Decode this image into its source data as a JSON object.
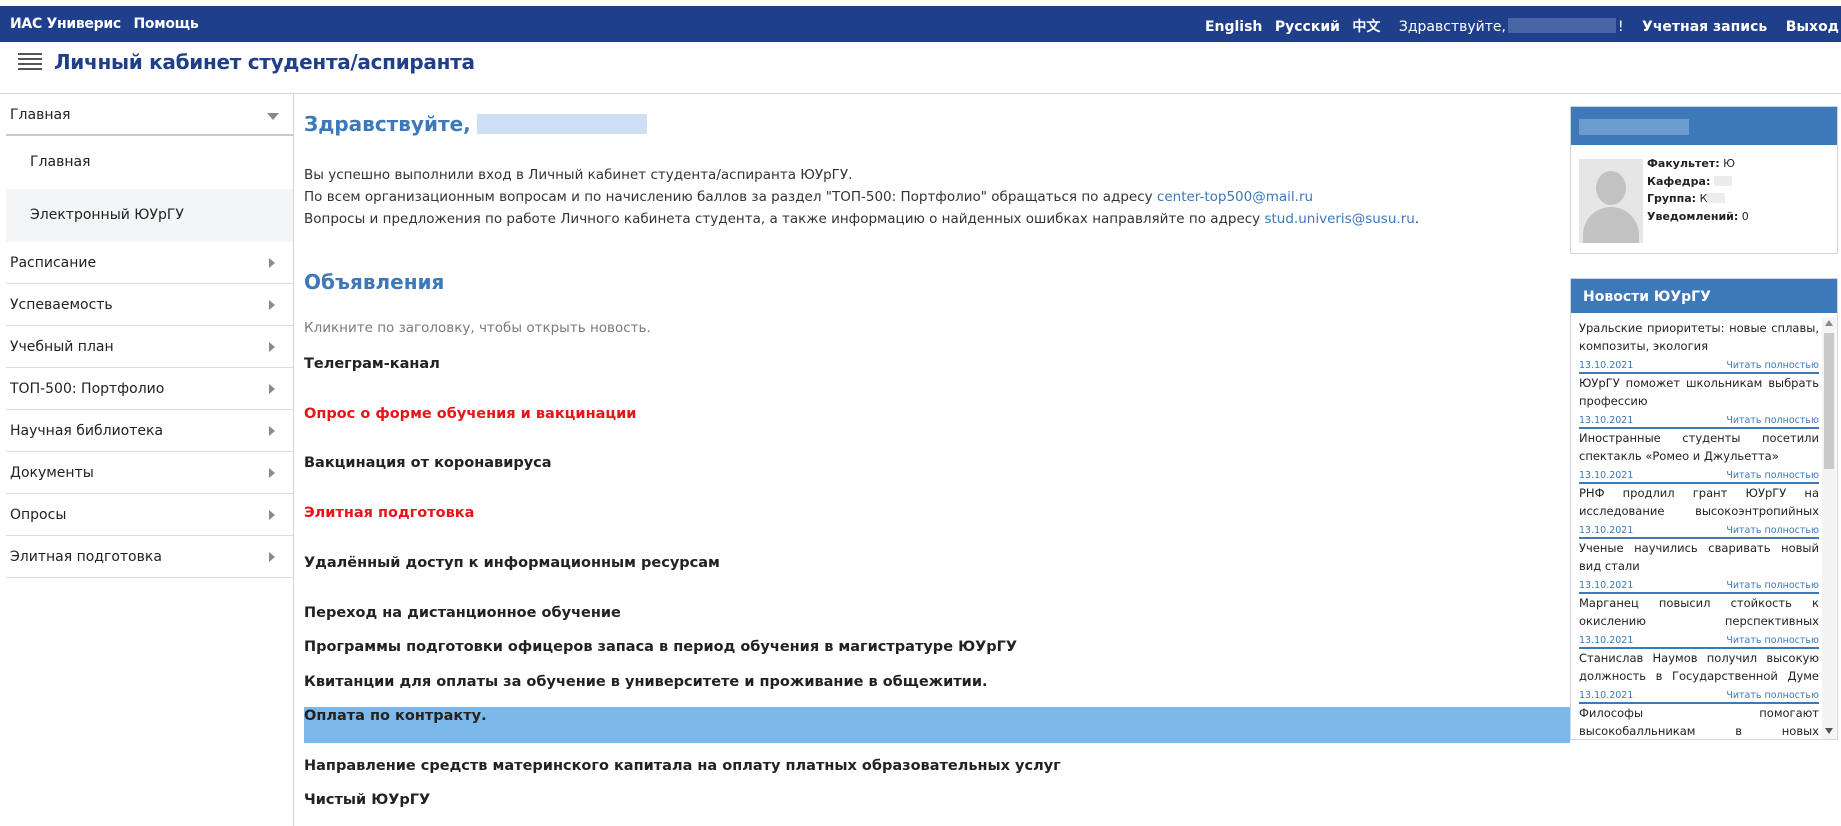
{
  "topbar": {
    "brand": "ИАС Универис",
    "help": "Помощь",
    "lang_en": "English",
    "lang_ru": "Русский",
    "lang_zh": "中文",
    "greeting": "Здравствуйте,",
    "greeting_end": "!",
    "account": "Учетная запись",
    "logout": "Выход"
  },
  "header": {
    "title": "Личный кабинет студента/аспиранта"
  },
  "sidebar": {
    "main_label": "Главная",
    "sub_items": [
      "Главная",
      "Электронный ЮУрГУ"
    ],
    "items": [
      "Расписание",
      "Успеваемость",
      "Учебный план",
      "ТОП-500: Портфолио",
      "Научная библиотека",
      "Документы",
      "Опросы",
      "Элитная подготовка"
    ]
  },
  "main": {
    "hello": "Здравствуйте,",
    "intro_1": "Вы успешно выполнили вход в Личный кабинет студента/аспиранта ЮУрГУ.",
    "intro_2": "По всем организационным вопросам и по начислению баллов за раздел \"ТОП-500: Портфолио\" обращаться по адресу",
    "intro_2_email": "center-top500@mail.ru",
    "intro_3": "Вопросы и предложения по работе Личного кабинета студента, а также информацию о найденных ошибках направляйте по адресу",
    "intro_3_email": "stud.univeris@susu.ru",
    "intro_3_end": ".",
    "announcements_title": "Объявления",
    "hint": "Кликните по заголовку, чтобы открыть новость.",
    "announcements": [
      "Телеграм-канал",
      "Опрос о форме обучения и вакцинации",
      "Вакцинация от коронавируса",
      "Элитная подготовка",
      "Удалённый доступ к информационным ресурсам",
      "Переход на дистанционное обучение",
      "Программы подготовки офицеров запаса в период обучения в магистратуре ЮУрГУ",
      "Квитанции для оплаты за обучение в университете и проживание в общежитии.",
      "Оплата по контракту.",
      "Направление средств материнского капитала на оплату платных образовательных услуг",
      "Чистый ЮУрГУ"
    ]
  },
  "profile": {
    "faculty_label": "Факультет:",
    "faculty_value": "Ю",
    "dept_label": "Кафедра:",
    "group_label": "Группа:",
    "group_value": "К",
    "notify_label": "Уведомлений:",
    "notify_value": "0"
  },
  "news": {
    "title": "Новости ЮУрГУ",
    "read_more": "Читать полностью",
    "items": [
      {
        "text": "Уральские приоритеты: новые сплавы, композиты, экология",
        "date": "13.10.2021"
      },
      {
        "text": "ЮУрГУ поможет школьникам выбрать профессию",
        "date": "13.10.2021"
      },
      {
        "text": "Иностранные студенты посетили спектакль «Ромео и Джульетта»",
        "date": "13.10.2021"
      },
      {
        "text": "РНФ продлил грант ЮУрГУ на исследование высокоэнтропийных магнетоплюмбитов",
        "date": "13.10.2021"
      },
      {
        "text": "Ученые научились сваривать новый вид стали",
        "date": "13.10.2021"
      },
      {
        "text": "Марганец повысил стойкость к окислению перспективных высокоэнтропийных сплавов",
        "date": "13.10.2021"
      },
      {
        "text": "Станислав Наумов получил высокую должность в Государственной Думе России",
        "date": "13.10.2021"
      },
      {
        "text": "Философы помогают высокобалльникам в новых достижениях",
        "date": ""
      }
    ]
  },
  "colors": {
    "topbar": "#1f3f8a",
    "accent": "#3d78b8",
    "highlight": "#7db8ea",
    "red": "#e8141a"
  }
}
